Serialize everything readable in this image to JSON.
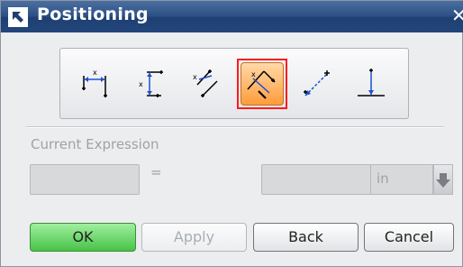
{
  "dialog": {
    "title": "Positioning",
    "close_glyph": "✕"
  },
  "toolbar": {
    "tools": [
      {
        "name": "horizontal-dimension-icon",
        "active": false
      },
      {
        "name": "vertical-dimension-icon",
        "active": false
      },
      {
        "name": "parallel-dimension-icon",
        "active": false
      },
      {
        "name": "perpendicular-dimension-icon",
        "active": true
      },
      {
        "name": "parallel-at-distance-icon",
        "active": false
      },
      {
        "name": "point-onto-line-icon",
        "active": false
      }
    ]
  },
  "expression": {
    "label": "Current Expression",
    "equals": "=",
    "unit": "in"
  },
  "buttons": {
    "ok": "OK",
    "apply": "Apply",
    "back": "Back",
    "cancel": "Cancel"
  },
  "colors": {
    "title_bar": "#2b4f84",
    "active_tool_border": "#ff1a1a",
    "active_tool_fill": "#ff9c3a",
    "ok_button": "#48c248"
  }
}
